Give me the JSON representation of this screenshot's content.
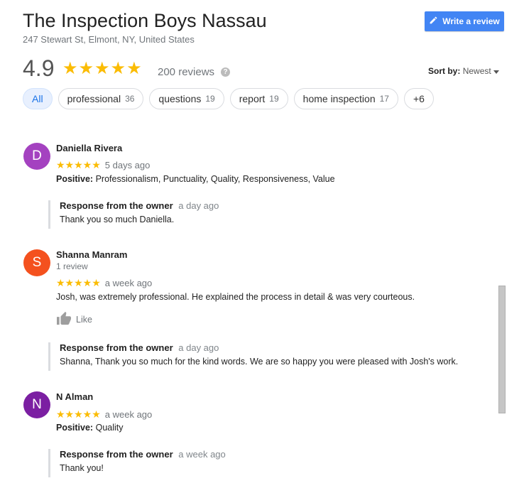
{
  "business": {
    "name": "The Inspection Boys Nassau",
    "address": "247 Stewart St, Elmont, NY, United States",
    "rating": "4.9",
    "stars": "★★★★★",
    "review_count": "200 reviews",
    "help_symbol": "?"
  },
  "write_review": {
    "label": "Write a review",
    "icon": "pencil-icon"
  },
  "sort": {
    "label": "Sort by:",
    "value": "Newest"
  },
  "filters": [
    {
      "label": "All",
      "count": ""
    },
    {
      "label": "professional",
      "count": "36"
    },
    {
      "label": "questions",
      "count": "19"
    },
    {
      "label": "report",
      "count": "19"
    },
    {
      "label": "home inspection",
      "count": "17"
    },
    {
      "label": "+6",
      "count": ""
    }
  ],
  "reviews": [
    {
      "initial": "D",
      "avatar_color": "#a442c0",
      "name": "Daniella Rivera",
      "sub": "",
      "stars": "★★★★★",
      "ago": "5 days ago",
      "positive_label": "Positive:",
      "positive": "Professionalism, Punctuality, Quality, Responsiveness, Value",
      "text": "",
      "response_label": "Response from the owner",
      "response_ago": "a day ago",
      "response_text": "Thank you so much Daniella."
    },
    {
      "initial": "S",
      "avatar_color": "#f4511e",
      "name": "Shanna Manram",
      "sub": "1 review",
      "stars": "★★★★★",
      "ago": "a week ago",
      "positive_label": "",
      "positive": "",
      "text": "Josh, was extremely professional.  He explained the process in detail & was very courteous.",
      "like_label": "Like",
      "response_label": "Response from the owner",
      "response_ago": "a day ago",
      "response_text": "Shanna, Thank you so much for the kind words. We are so happy you were pleased with Josh's work."
    },
    {
      "initial": "N",
      "avatar_color": "#7b1fa2",
      "name": "N Alman",
      "sub": "",
      "stars": "★★★★★",
      "ago": "a week ago",
      "positive_label": "Positive:",
      "positive": "Quality",
      "text": "",
      "response_label": "Response from the owner",
      "response_ago": "a week ago",
      "response_text": "Thank you!"
    }
  ],
  "colors": {
    "star": "#fbbc04",
    "accent": "#4285f4",
    "active_chip": "#e8f0fe"
  }
}
